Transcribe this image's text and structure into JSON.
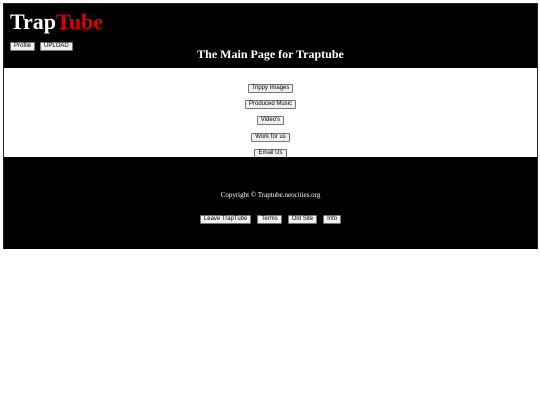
{
  "header": {
    "logo_part1": "Trap",
    "logo_part2": "Tube",
    "profile_label": "Profile",
    "upload_label": "UPLOAD",
    "title": "The Main Page for Traptube"
  },
  "main": {
    "nav": [
      {
        "label": "Trippy Images"
      },
      {
        "label": "Produced Music"
      },
      {
        "label": "Video's"
      },
      {
        "label": "Work for us"
      },
      {
        "label": "Email Us"
      }
    ]
  },
  "footer": {
    "copyright": "Copyright © Traptube.neocities.org",
    "buttons": [
      {
        "label": "Leave TrapTube"
      },
      {
        "label": "Terms"
      },
      {
        "label": "Old Site"
      },
      {
        "label": "Info"
      }
    ]
  },
  "colors": {
    "background": "#000000",
    "logo_accent": "#d40000",
    "text": "#ffffff"
  }
}
